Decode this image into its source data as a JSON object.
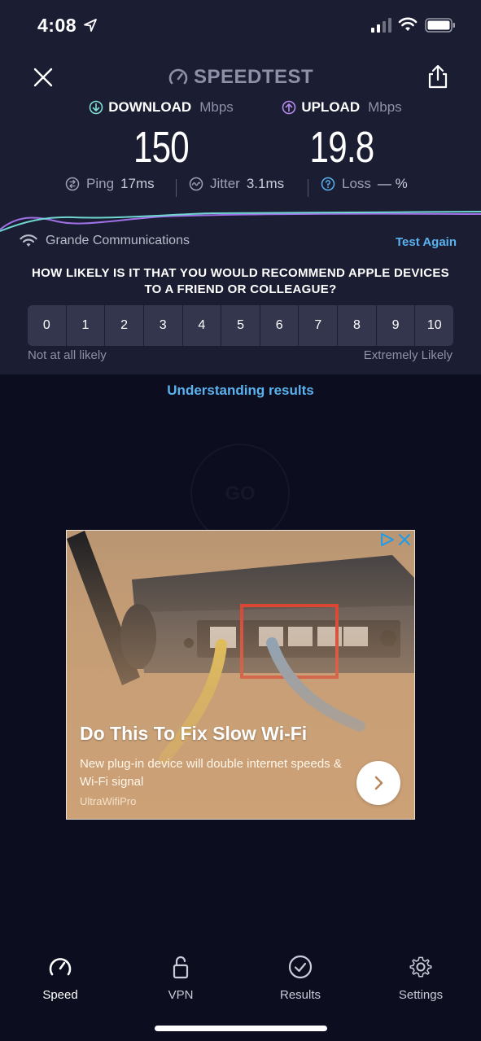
{
  "status_bar": {
    "time": "4:08",
    "icons": [
      "location-arrow-icon",
      "cellular-signal-icon",
      "wifi-icon",
      "battery-icon"
    ]
  },
  "header": {
    "brand": "SPEEDTEST",
    "close_icon": "close-icon",
    "share_icon": "share-icon"
  },
  "results": {
    "download": {
      "label": "DOWNLOAD",
      "unit": "Mbps",
      "value": "150",
      "icon": "download-arrow-icon",
      "color": "#7fe0d6"
    },
    "upload": {
      "label": "UPLOAD",
      "unit": "Mbps",
      "value": "19.8",
      "icon": "upload-arrow-icon",
      "color": "#b58ced"
    },
    "ping": {
      "label": "Ping",
      "value": "17",
      "unit": "ms"
    },
    "jitter": {
      "label": "Jitter",
      "value": "3.1",
      "unit": "ms"
    },
    "loss": {
      "label": "Loss",
      "value": "—",
      "unit": "%"
    }
  },
  "provider": {
    "name": "Grande Communications",
    "action": "Test Again"
  },
  "survey": {
    "question_line1": "HOW LIKELY IS IT THAT YOU WOULD RECOMMEND APPLE DEVICES",
    "question_line2": "TO A FRIEND OR COLLEAGUE?",
    "options": [
      "0",
      "1",
      "2",
      "3",
      "4",
      "5",
      "6",
      "7",
      "8",
      "9",
      "10"
    ],
    "low_label": "Not at all likely",
    "high_label": "Extremely Likely"
  },
  "understanding_link": "Understanding results",
  "go_button": "GO",
  "ad": {
    "headline": "Do This To Fix Slow Wi-Fi",
    "body": "New plug-in device will double internet speeds & Wi-Fi signal",
    "source": "UltraWifiPro"
  },
  "tabs": [
    {
      "label": "Speed",
      "icon": "speedometer-icon",
      "active": true
    },
    {
      "label": "VPN",
      "icon": "lock-icon",
      "active": false
    },
    {
      "label": "Results",
      "icon": "checkmark-circle-icon",
      "active": false
    },
    {
      "label": "Settings",
      "icon": "gear-icon",
      "active": false
    }
  ],
  "colors": {
    "background": "#0c0d1e",
    "panel": "#1b1d33",
    "accent_link": "#5ab2ee",
    "download": "#7fe0d6",
    "upload": "#b58ced"
  }
}
